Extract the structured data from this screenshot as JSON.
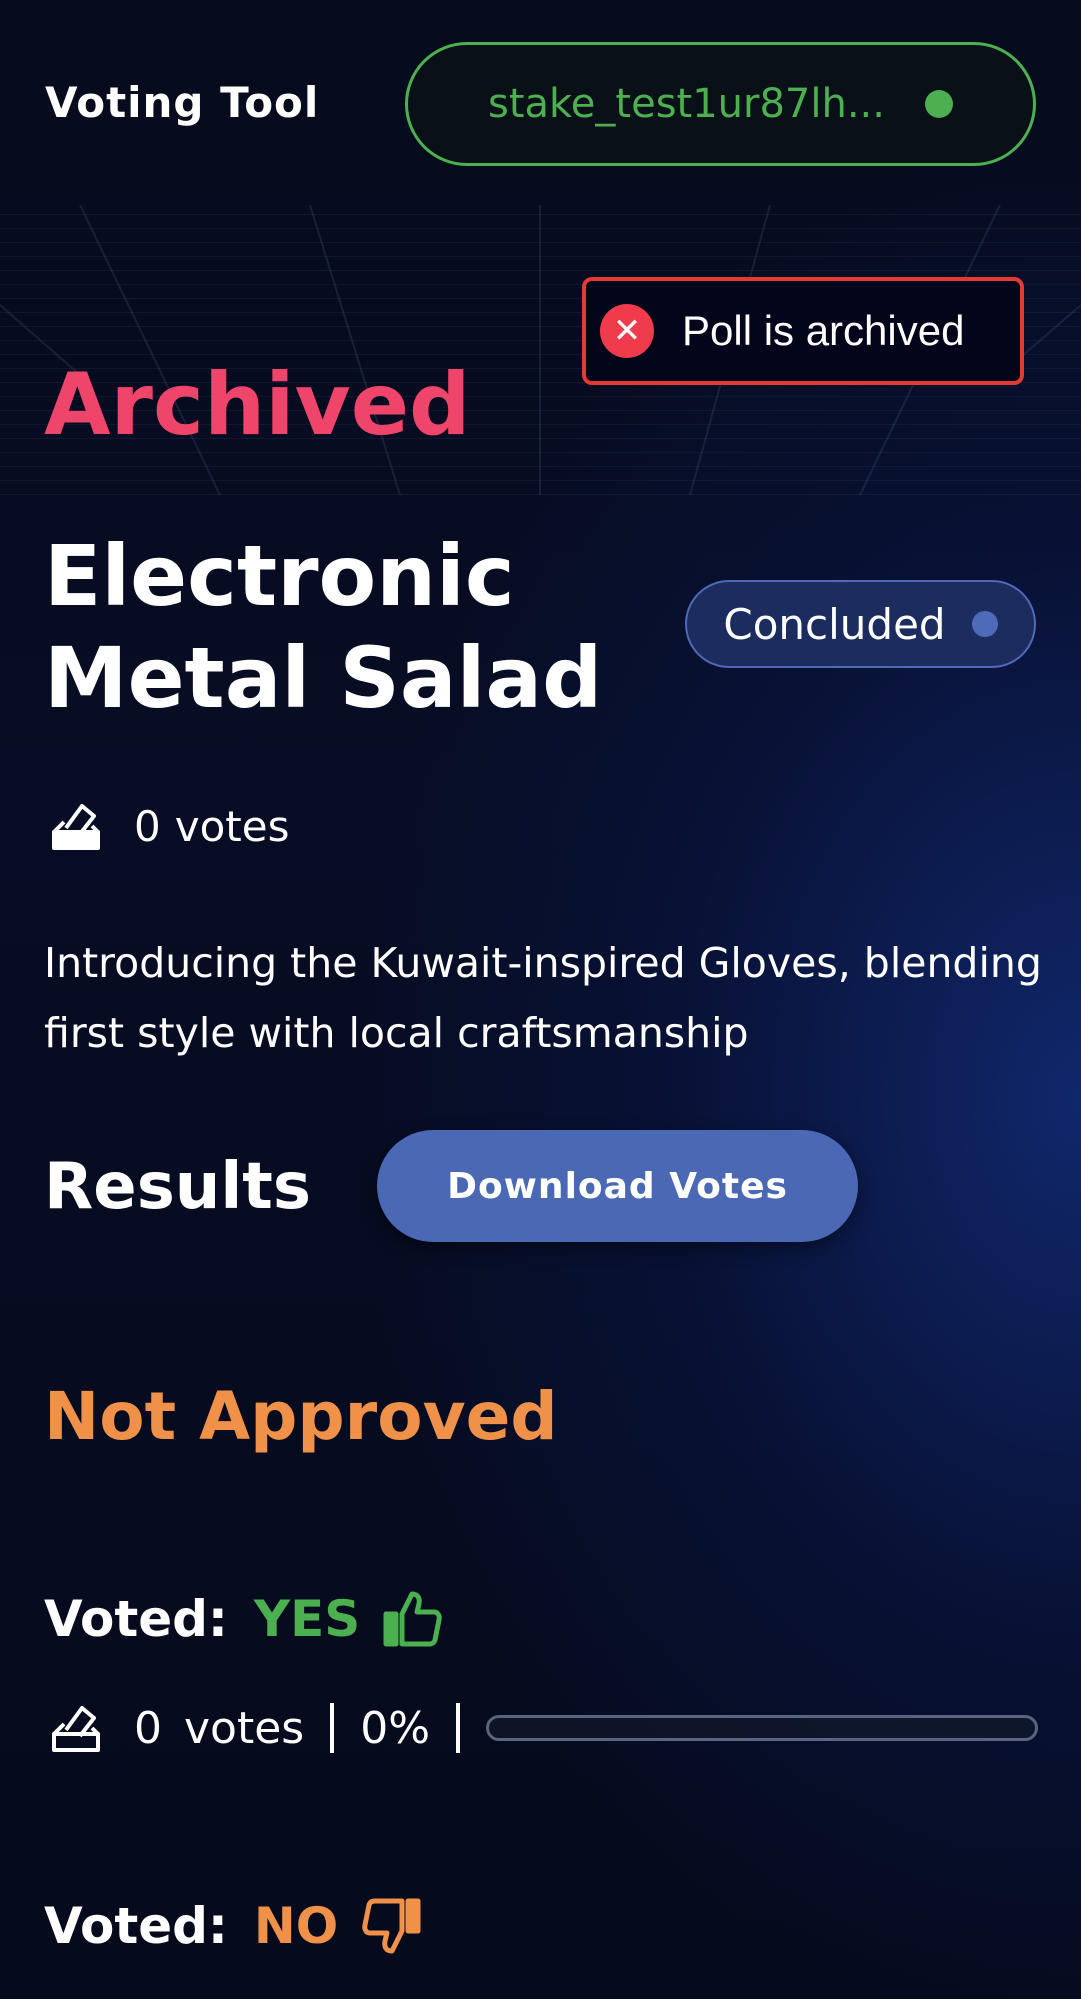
{
  "header": {
    "title": "Voting Tool",
    "wallet_address": "stake_test1ur87lh...",
    "wallet_status_color": "#4caf50"
  },
  "toast": {
    "message": "Poll is archived",
    "icon": "close-icon",
    "color": "#e53935"
  },
  "poll": {
    "state_heading": "Archived",
    "title": "Electronic Metal Salad",
    "status": "Concluded",
    "vote_count": "0",
    "vote_count_unit": "votes",
    "description": "Introducing the Kuwait-inspired Gloves, blending first style with local craftsmanship"
  },
  "results": {
    "label": "Results",
    "download_label": "Download Votes",
    "outcome": "Not Approved",
    "voted_label": "Voted:",
    "options": [
      {
        "value": "YES",
        "icon": "thumbs-up-icon",
        "color": "#4caf50",
        "votes": "0",
        "votes_unit": "votes",
        "percent_text": "0%",
        "percent": 0
      },
      {
        "value": "NO",
        "icon": "thumbs-down-icon",
        "color": "#f0914a"
      }
    ]
  }
}
